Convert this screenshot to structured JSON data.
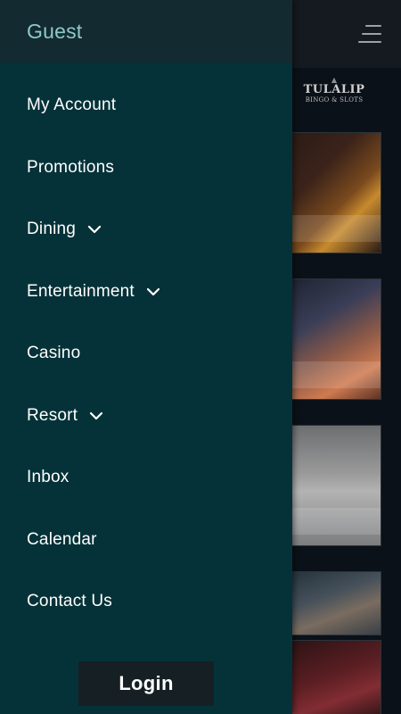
{
  "drawer": {
    "user_label": "Guest",
    "menu": [
      {
        "label": "My Account",
        "has_submenu": false,
        "icon": "none"
      },
      {
        "label": "Promotions",
        "has_submenu": false,
        "icon": "none"
      },
      {
        "label": "Dining",
        "has_submenu": true,
        "icon": "chevron-down-icon"
      },
      {
        "label": "Entertainment",
        "has_submenu": true,
        "icon": "chevron-down-icon"
      },
      {
        "label": "Casino",
        "has_submenu": false,
        "icon": "none"
      },
      {
        "label": "Resort",
        "has_submenu": true,
        "icon": "chevron-down-icon"
      },
      {
        "label": "Inbox",
        "has_submenu": false,
        "icon": "none"
      },
      {
        "label": "Calendar",
        "has_submenu": false,
        "icon": "none"
      },
      {
        "label": "Contact Us",
        "has_submenu": false,
        "icon": "none"
      }
    ],
    "login_label": "Login"
  },
  "background": {
    "logo": {
      "name": "TULALIP",
      "subtitle": "BINGO & SLOTS"
    },
    "menu_icon": "hamburger-menu-icon"
  },
  "colors": {
    "drawer_bg": "#053238",
    "drawer_header_bg": "#132a30",
    "guest_text": "#8cc9c9",
    "menu_text": "#ffffff",
    "login_bg": "#162024"
  }
}
